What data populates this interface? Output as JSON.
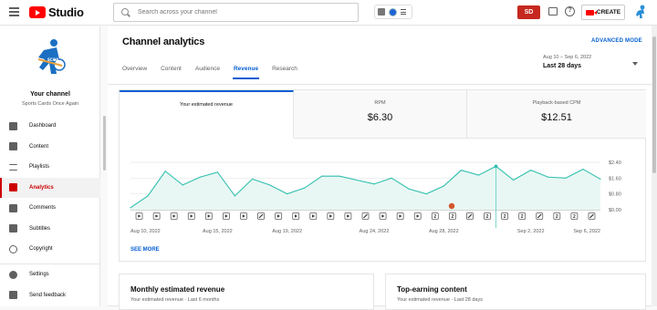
{
  "header": {
    "logo_text": "Studio",
    "search_placeholder": "Search across your channel",
    "create_label": "CREATE",
    "extension_badge": "SD"
  },
  "sidebar": {
    "your_channel_label": "Your channel",
    "channel_name": "Sports Cards Once Again",
    "items": [
      {
        "label": "Dashboard",
        "icon": "dashboard-icon",
        "active": false
      },
      {
        "label": "Content",
        "icon": "content-icon",
        "active": false
      },
      {
        "label": "Playlists",
        "icon": "playlists-icon",
        "active": false
      },
      {
        "label": "Analytics",
        "icon": "analytics-icon",
        "active": true
      },
      {
        "label": "Comments",
        "icon": "comments-icon",
        "active": false
      },
      {
        "label": "Subtitles",
        "icon": "subtitles-icon",
        "active": false
      },
      {
        "label": "Copyright",
        "icon": "copyright-icon",
        "active": false
      }
    ],
    "bottom_items": [
      {
        "label": "Settings",
        "icon": "settings-icon"
      },
      {
        "label": "Send feedback",
        "icon": "feedback-icon"
      }
    ]
  },
  "main": {
    "title": "Channel analytics",
    "advanced_mode": "ADVANCED MODE",
    "tabs": [
      "Overview",
      "Content",
      "Audience",
      "Revenue",
      "Research"
    ],
    "active_tab": "Revenue",
    "date_range": "Aug 10 – Sep 6, 2022",
    "date_label": "Last 28 days",
    "metrics": [
      {
        "label": "Your estimated revenue",
        "value": ""
      },
      {
        "label": "RPM",
        "value": "$6.30"
      },
      {
        "label": "Playback-based CPM",
        "value": "$12.51"
      }
    ],
    "see_more": "SEE MORE",
    "bottom_cards": [
      {
        "title": "Monthly estimated revenue",
        "caption": "Your estimated revenue · Last 6 months"
      },
      {
        "title": "Top-earning content",
        "caption": "Your estimated revenue · Last 28 days"
      }
    ]
  },
  "colors": {
    "accent": "#065fd4",
    "brand_red": "#ff0000",
    "active_red": "#cc0000",
    "chart_line": "#2fbfad",
    "chart_fill": "#e8f7f4"
  },
  "chart_data": {
    "type": "area",
    "x": [
      "Aug 10",
      "Aug 11",
      "Aug 12",
      "Aug 13",
      "Aug 14",
      "Aug 15",
      "Aug 16",
      "Aug 17",
      "Aug 18",
      "Aug 19",
      "Aug 20",
      "Aug 21",
      "Aug 22",
      "Aug 23",
      "Aug 24",
      "Aug 25",
      "Aug 26",
      "Aug 27",
      "Aug 28",
      "Aug 29",
      "Aug 30",
      "Aug 31",
      "Sep 1",
      "Sep 2",
      "Sep 3",
      "Sep 4",
      "Sep 5",
      "Sep 6"
    ],
    "series": [
      {
        "values": [
          0.1,
          0.7,
          1.95,
          1.25,
          1.65,
          1.9,
          0.7,
          1.55,
          1.25,
          0.8,
          1.1,
          1.7,
          1.7,
          1.5,
          1.3,
          1.6,
          1.05,
          0.8,
          1.2,
          2.0,
          1.75,
          2.2,
          1.5,
          2.0,
          1.65,
          1.6,
          2.05,
          1.55
        ]
      }
    ],
    "x_tick_labels": [
      "Aug 10, 2022",
      "Aug 15, 2022",
      "Aug 19, 2022",
      "Aug 24, 2022",
      "Aug 28, 2022",
      "Sep 2, 2022",
      "Sep 6, 2022"
    ],
    "y_ticks": [
      "$2.40",
      "$1.60",
      "$0.80",
      "$0.00"
    ],
    "ylim": [
      0,
      2.4
    ],
    "grid": true,
    "video_markers": [
      "play",
      "play",
      "play",
      "play",
      "play",
      "play",
      "play",
      "shorts",
      "play",
      "play",
      "play",
      "play",
      "play",
      "shorts",
      "play",
      "play",
      "play",
      "2",
      "2",
      "shorts",
      "2",
      "2",
      "2",
      "shorts",
      "2",
      "2",
      "shorts"
    ],
    "highlight_index": 21
  }
}
